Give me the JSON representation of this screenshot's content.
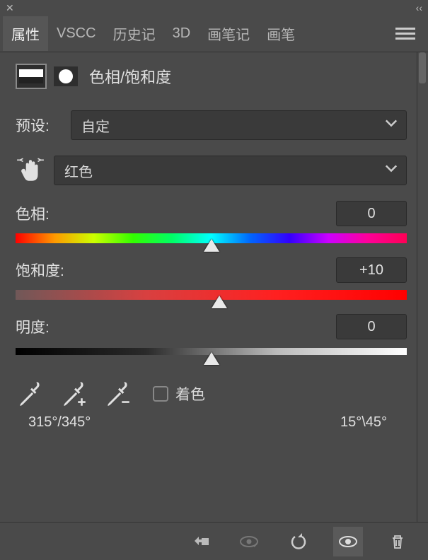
{
  "tabs": {
    "active": "属性",
    "items": [
      "属性",
      "VSCC",
      "历史记",
      "3D",
      "画笔记",
      "画笔"
    ]
  },
  "head_label": "色相/饱和度",
  "preset": {
    "label": "预设:",
    "value": "自定"
  },
  "channel": {
    "value": "红色"
  },
  "sliders": {
    "hue": {
      "label": "色相:",
      "value": "0",
      "pos": 50
    },
    "sat": {
      "label": "饱和度:",
      "value": "+10",
      "pos": 52
    },
    "light": {
      "label": "明度:",
      "value": "0",
      "pos": 50
    }
  },
  "colorize_label": "着色",
  "range_left": "315°/345°",
  "range_right": "15°\\45°"
}
